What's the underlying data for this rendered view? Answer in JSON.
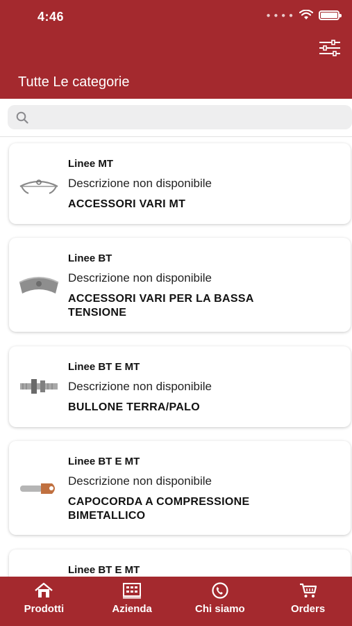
{
  "status_bar": {
    "time": "4:46"
  },
  "header": {
    "title": "Tutte Le categorie"
  },
  "search": {
    "placeholder": ""
  },
  "products": [
    {
      "category": "Linee MT",
      "description": "Descrizione non disponibile",
      "name": "ACCESSORI VARI MT"
    },
    {
      "category": "Linee BT",
      "description": "Descrizione non disponibile",
      "name": "ACCESSORI VARI PER LA BASSA TENSIONE"
    },
    {
      "category": "Linee BT E MT",
      "description": "Descrizione non disponibile",
      "name": "BULLONE TERRA/PALO"
    },
    {
      "category": "Linee BT E MT",
      "description": "Descrizione non disponibile",
      "name": "CAPOCORDA A COMPRESSIONE BIMETALLICO"
    },
    {
      "category": "Linee BT E MT",
      "description": "",
      "name": ""
    }
  ],
  "tabbar": {
    "tabs": [
      {
        "label": "Prodotti",
        "icon": "home-icon"
      },
      {
        "label": "Azienda",
        "icon": "building-icon"
      },
      {
        "label": "Chi siamo",
        "icon": "phone-icon"
      },
      {
        "label": "Orders",
        "icon": "cart-icon"
      }
    ]
  },
  "colors": {
    "brand": "#a4292e",
    "background": "#ffffff",
    "search_bg": "#eeeeef"
  }
}
